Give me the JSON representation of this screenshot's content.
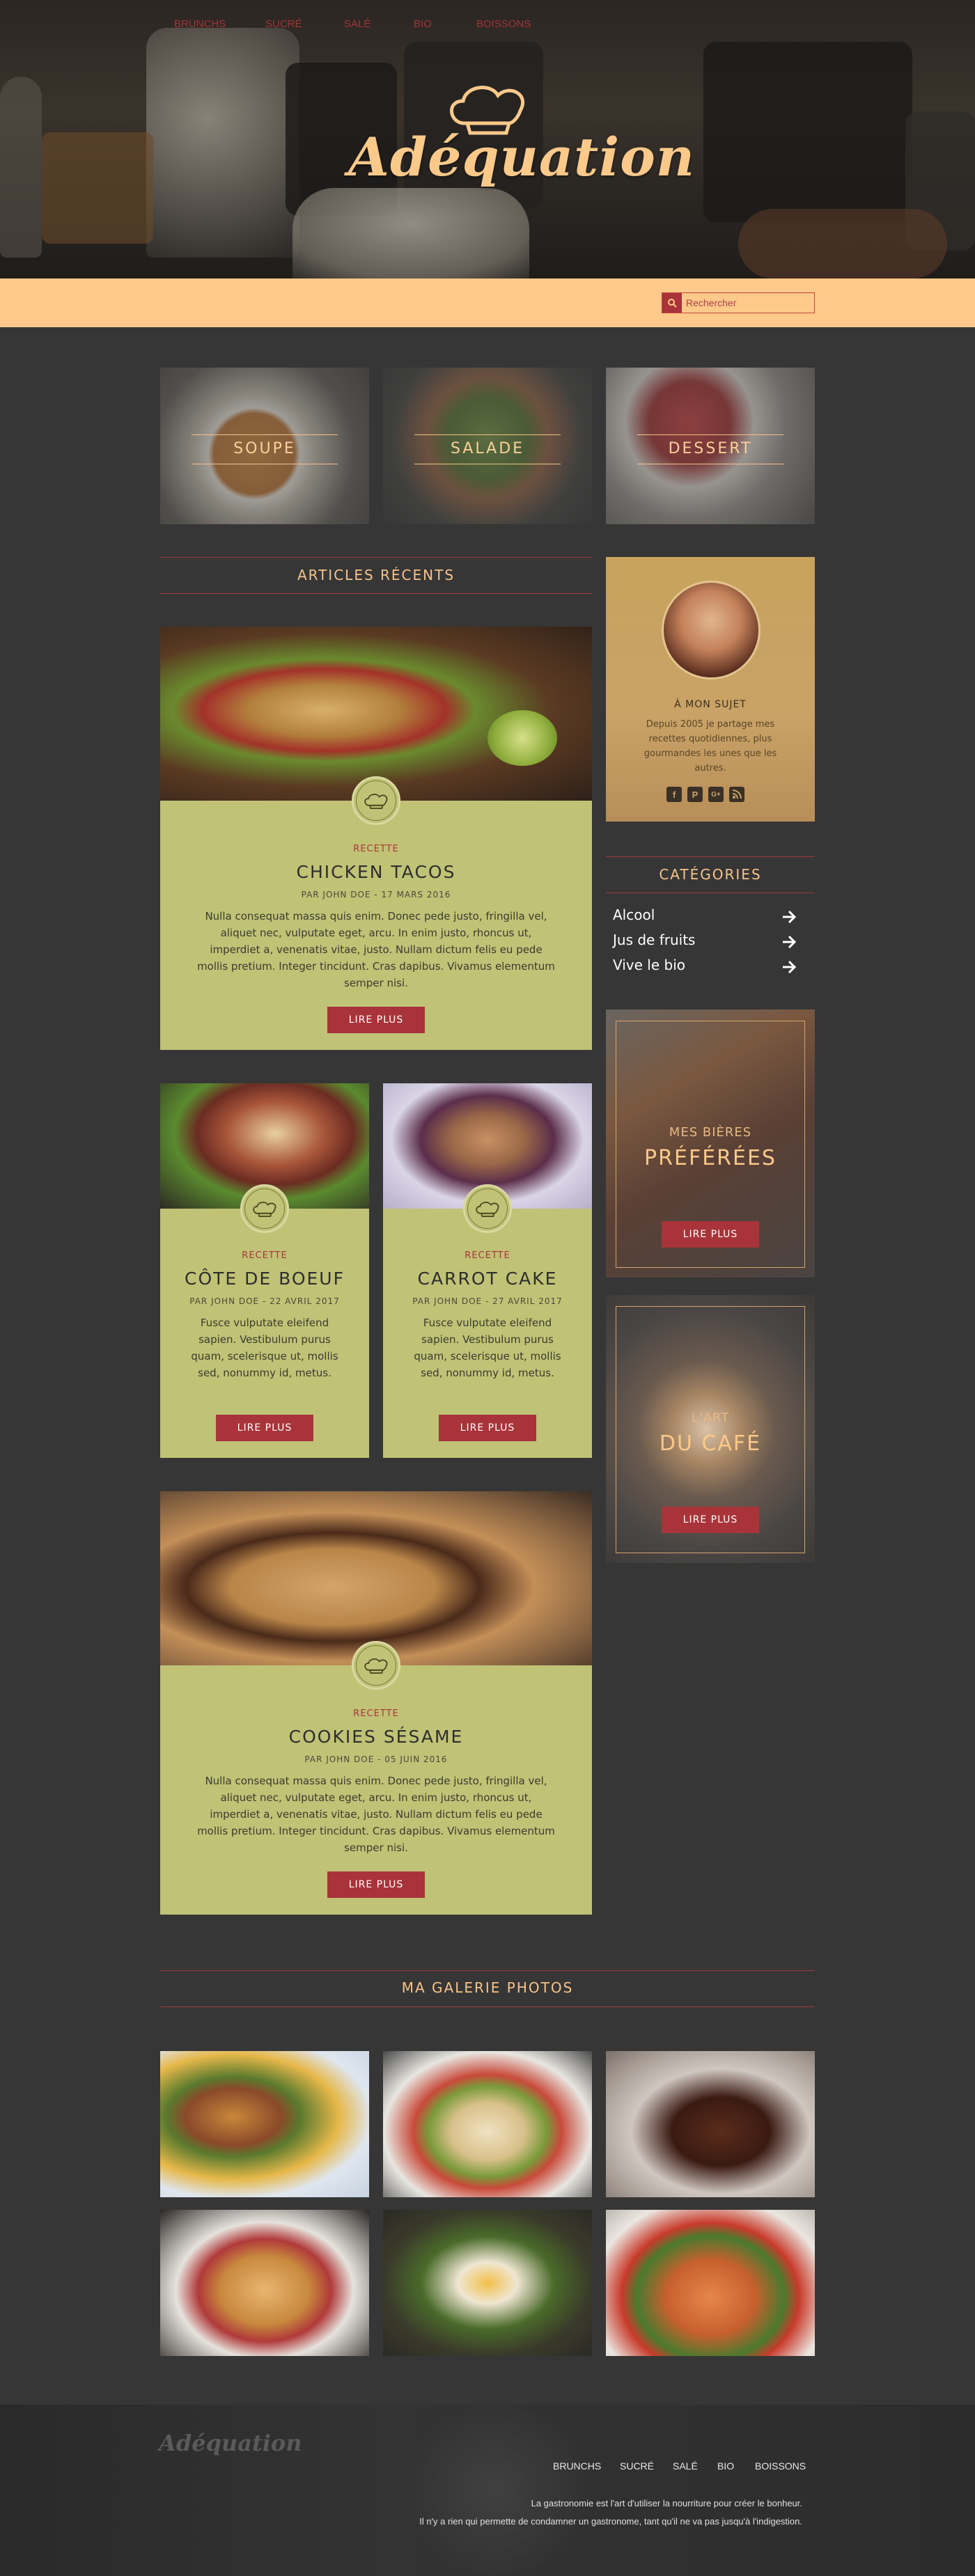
{
  "brand": {
    "name": "Adéquation"
  },
  "nav": {
    "items": [
      "BRUNCHS",
      "SUCRÉ",
      "SALÉ",
      "BIO",
      "BOISSONS"
    ]
  },
  "search": {
    "placeholder": "Rechercher"
  },
  "tiles": [
    {
      "label": "SOUPE"
    },
    {
      "label": "SALADE"
    },
    {
      "label": "DESSERT"
    }
  ],
  "recent": {
    "title": "ARTICLES RÉCENTS"
  },
  "articles": [
    {
      "kicker": "RECETTE",
      "title": "CHICKEN TACOS",
      "meta": "PAR JOHN DOE - 17 MARS 2016",
      "text": "Nulla consequat massa quis enim. Donec pede justo, fringilla vel, aliquet nec, vulputate eget, arcu. In enim justo, rhoncus ut, imperdiet a, venenatis vitae, justo. Nullam dictum felis eu pede mollis pretium. Integer tincidunt. Cras dapibus. Vivamus elementum semper nisi.",
      "button": "LIRE PLUS"
    },
    {
      "kicker": "RECETTE",
      "title": "CÔTE DE BOEUF",
      "meta": "PAR JOHN DOE - 22 AVRIL 2017",
      "text": "Fusce vulputate eleifend sapien. Vestibulum purus quam, scelerisque ut, mollis sed, nonummy id, metus.",
      "button": "LIRE PLUS"
    },
    {
      "kicker": "RECETTE",
      "title": "CARROT CAKE",
      "meta": "PAR JOHN DOE - 27 AVRIL 2017",
      "text": "Fusce vulputate eleifend sapien. Vestibulum purus quam, scelerisque ut, mollis sed, nonummy id, metus.",
      "button": "LIRE PLUS"
    },
    {
      "kicker": "RECETTE",
      "title": "COOKIES SÉSAME",
      "meta": "PAR JOHN DOE - 05 JUIN 2016",
      "text": "Nulla consequat massa quis enim. Donec pede justo, fringilla vel, aliquet nec, vulputate eget, arcu. In enim justo, rhoncus ut, imperdiet a, venenatis vitae, justo. Nullam dictum felis eu pede mollis pretium. Integer tincidunt. Cras dapibus. Vivamus elementum semper nisi.",
      "button": "LIRE PLUS"
    }
  ],
  "about": {
    "title": "À MON SUJET",
    "text": "Depuis 2005 je partage mes recettes quotidiennes, plus gourmandes les unes que les autres.",
    "social": [
      "f",
      "P",
      "G+",
      "rss"
    ]
  },
  "categories": {
    "title": "CATÉGORIES",
    "items": [
      "Alcool",
      "Jus de fruits",
      "Vive le bio"
    ]
  },
  "promos": [
    {
      "small": "MES BIÈRES",
      "big": "PRÉFÉRÉES",
      "button": "LIRE PLUS"
    },
    {
      "small": "L'ART",
      "big": "DU CAFÉ",
      "button": "LIRE PLUS"
    }
  ],
  "gallery": {
    "title": "MA GALERIE PHOTOS"
  },
  "footer": {
    "logo": "Adéquation",
    "nav": [
      "BRUNCHS",
      "SUCRÉ",
      "SALÉ",
      "BIO",
      "BOISSONS"
    ],
    "line1": "La gastronomie est l'art d'utiliser la nourriture pour créer le bonheur.",
    "line2": "Il n'y a rien qui permette de condamner un gastronome, tant qu'il ne va pas jusqu'à l'indigestion."
  },
  "colors": {
    "accent": "#fec98a",
    "red": "#a8343a",
    "card": "#c0c276",
    "bg": "#363636"
  }
}
